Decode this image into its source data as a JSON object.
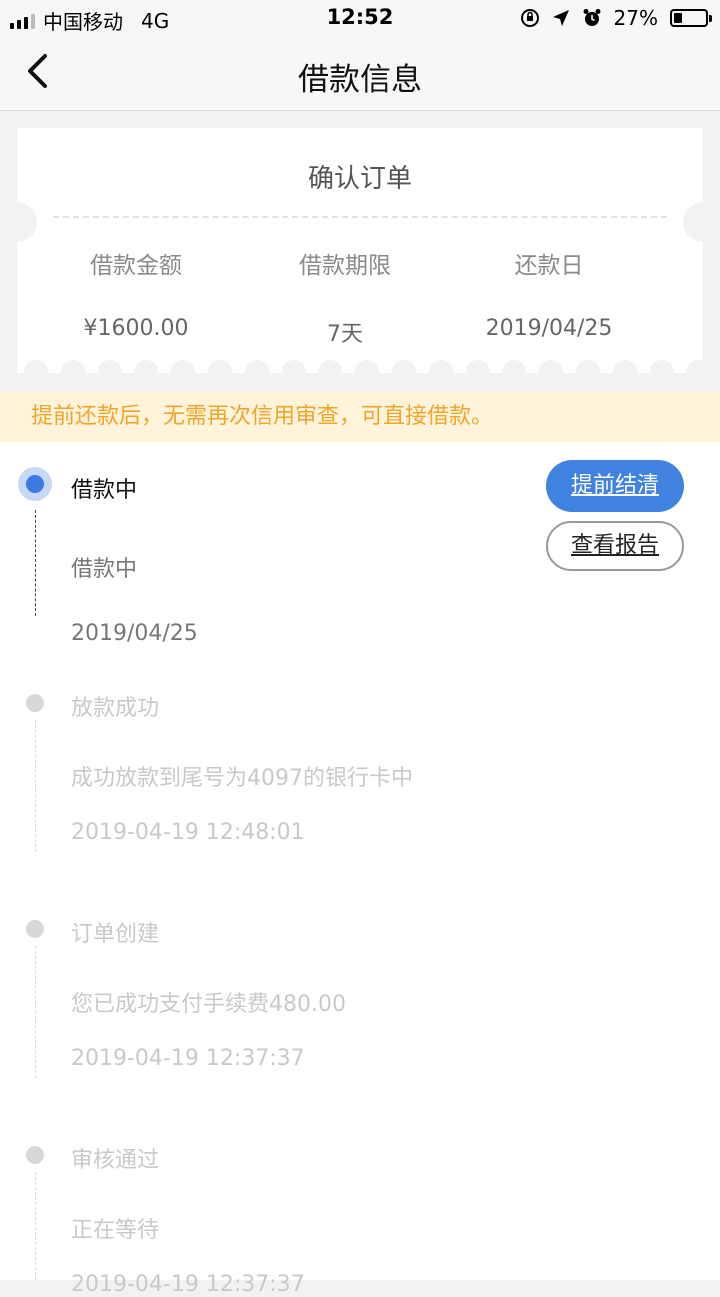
{
  "status_bar": {
    "carrier": "中国移动",
    "network": "4G",
    "time": "12:52",
    "battery_percent": "27%",
    "battery_level": 0.27,
    "icons": [
      "signal-icon",
      "orientation-lock-icon",
      "location-arrow-icon",
      "alarm-icon",
      "battery-icon"
    ]
  },
  "header": {
    "title": "借款信息",
    "back_icon": "chevron-left-icon"
  },
  "ticket": {
    "title": "确认订单",
    "columns": [
      {
        "label": "借款金额",
        "value": "¥1600.00"
      },
      {
        "label": "借款期限",
        "value": "7天"
      },
      {
        "label": "还款日",
        "value": "2019/04/25"
      }
    ]
  },
  "notice": "提前还款后，无需再次信用审查，可直接借款。",
  "actions": {
    "settle_label": "提前结清",
    "report_label": "查看报告"
  },
  "timeline": [
    {
      "title": "借款中",
      "detail": "借款中",
      "time": "2019/04/25",
      "active": true
    },
    {
      "title": "放款成功",
      "detail": "成功放款到尾号为4097的银行卡中",
      "time": "2019-04-19 12:48:01",
      "active": false
    },
    {
      "title": "订单创建",
      "detail": "您已成功支付手续费480.00",
      "time": "2019-04-19 12:37:37",
      "active": false
    },
    {
      "title": "审核通过",
      "detail": "正在等待",
      "time": "2019-04-19 12:37:37",
      "active": false
    }
  ],
  "colors": {
    "accent_blue": "#3f82e0",
    "notice_bg": "#fff3d9",
    "notice_text": "#f0a52c",
    "page_bg": "#f2f2f2"
  }
}
